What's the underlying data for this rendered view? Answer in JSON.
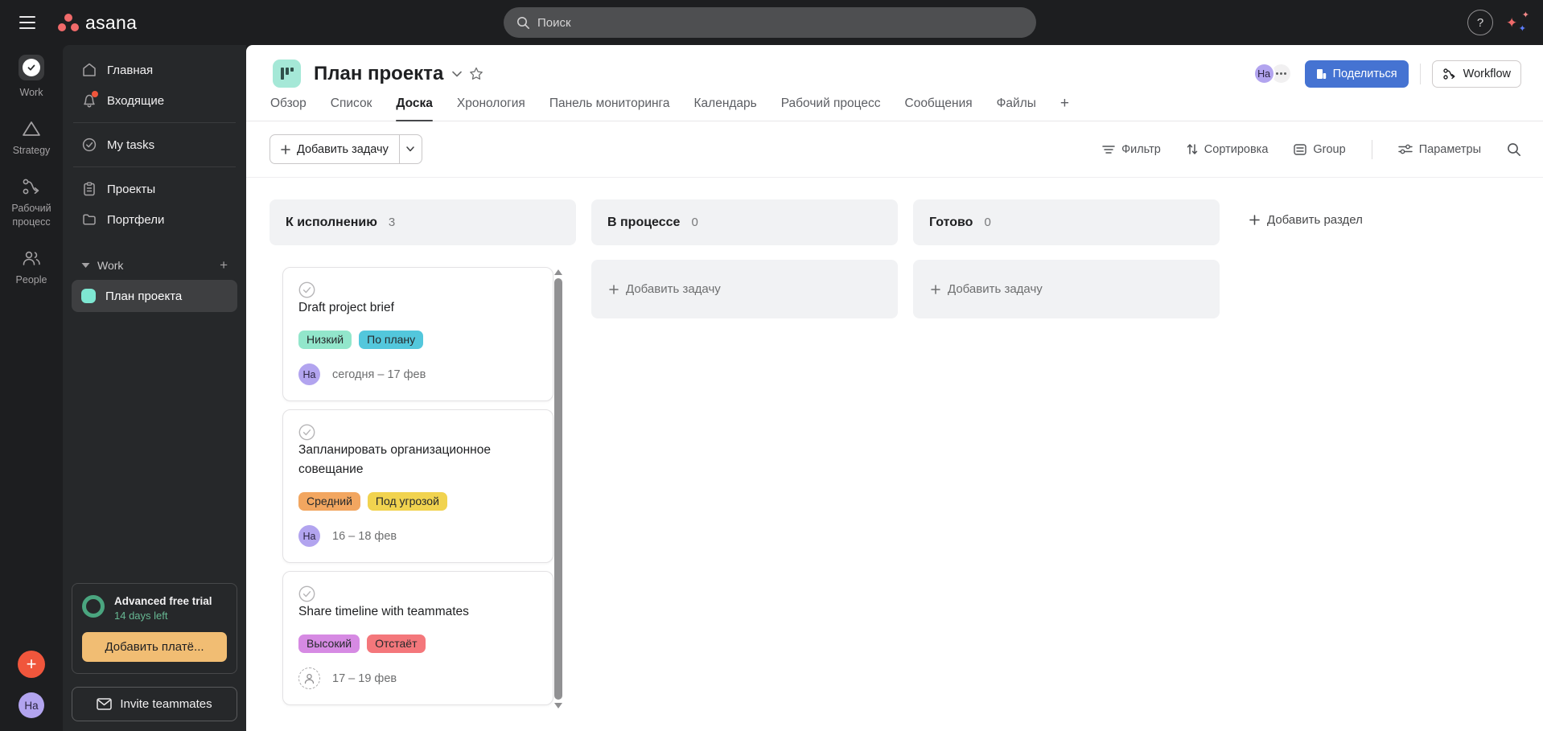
{
  "topbar": {
    "logo": "asana",
    "search_placeholder": "Поиск",
    "help": "?"
  },
  "rail": {
    "items": [
      {
        "label": "Work"
      },
      {
        "label": "Strategy"
      },
      {
        "label": "Рабочий процесс"
      },
      {
        "label": "People"
      }
    ],
    "avatar_initials": "На"
  },
  "sidebar": {
    "items": [
      {
        "label": "Главная"
      },
      {
        "label": "Входящие"
      },
      {
        "label": "My tasks"
      },
      {
        "label": "Проекты"
      },
      {
        "label": "Портфели"
      }
    ],
    "workspace_label": "Work",
    "projects": [
      {
        "label": "План проекта"
      }
    ],
    "trial": {
      "title": "Advanced free trial",
      "days_left": "14 days left",
      "upgrade_label": "Добавить платё..."
    },
    "invite_label": "Invite teammates"
  },
  "header": {
    "title": "План проекта",
    "avatar_initials": "На",
    "share_label": "Поделиться",
    "workflow_label": "Workflow"
  },
  "tabs": [
    {
      "label": "Обзор"
    },
    {
      "label": "Список"
    },
    {
      "label": "Доска",
      "active": true
    },
    {
      "label": "Хронология"
    },
    {
      "label": "Панель мониторинга"
    },
    {
      "label": "Календарь"
    },
    {
      "label": "Рабочий процесс"
    },
    {
      "label": "Сообщения"
    },
    {
      "label": "Файлы"
    },
    {
      "label": "+"
    }
  ],
  "toolbar": {
    "add_task_label": "Добавить задачу",
    "filter_label": "Фильтр",
    "sort_label": "Сортировка",
    "group_label": "Group",
    "options_label": "Параметры"
  },
  "board": {
    "add_section_label": "Добавить раздел",
    "add_task_label": "Добавить задачу",
    "columns": [
      {
        "title": "К исполнению",
        "count": "3",
        "cards": [
          {
            "title": "Draft project brief",
            "badges": [
              {
                "label": "Низкий",
                "bg": "#92e6cb"
              },
              {
                "label": "По плану",
                "bg": "#53c7dc"
              }
            ],
            "assignee": "На",
            "dates": "сегодня – 17 фев"
          },
          {
            "title": "Запланировать организационное совещание",
            "badges": [
              {
                "label": "Средний",
                "bg": "#f2a660"
              },
              {
                "label": "Под угрозой",
                "bg": "#f1d34f"
              }
            ],
            "assignee": "На",
            "dates": "16 – 18 фев"
          },
          {
            "title": "Share timeline with teammates",
            "badges": [
              {
                "label": "Высокий",
                "bg": "#d68ae3"
              },
              {
                "label": "Отстаёт",
                "bg": "#f4777b"
              }
            ],
            "assignee": null,
            "dates": "17 – 19 фев"
          }
        ]
      },
      {
        "title": "В процессе",
        "count": "0"
      },
      {
        "title": "Готово",
        "count": "0"
      }
    ]
  },
  "colors": {
    "accent_blue": "#4573d2",
    "brand_coral": "#f06a6a",
    "project_teal": "#7ee7d2",
    "upgrade_amber": "#f1bd73",
    "trial_green": "#4aa57f"
  }
}
